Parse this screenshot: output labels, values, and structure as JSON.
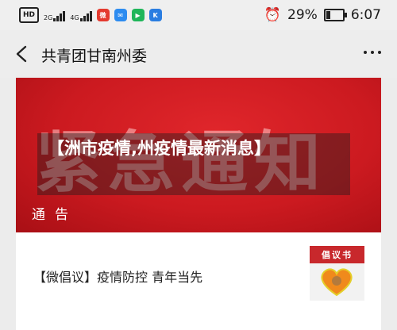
{
  "status_bar": {
    "hd_badge": "HD",
    "signal1_label": "2G",
    "signal2_label": "4G",
    "battery_pct": "29%",
    "battery_level": 0.29,
    "time": "6:07"
  },
  "header": {
    "title": "共青团甘南州委"
  },
  "banner": {
    "watermark": "紧急通知",
    "notice_word": "通告",
    "overlay_title": "【洲市疫情,州疫情最新消息】"
  },
  "article": {
    "title": "【微倡议】疫情防控  青年当先",
    "thumb_label": "倡议书"
  },
  "colors": {
    "banner_red": "#cc1a20",
    "thumb_red": "#c8282c",
    "heart_orange": "#f08a1c"
  }
}
